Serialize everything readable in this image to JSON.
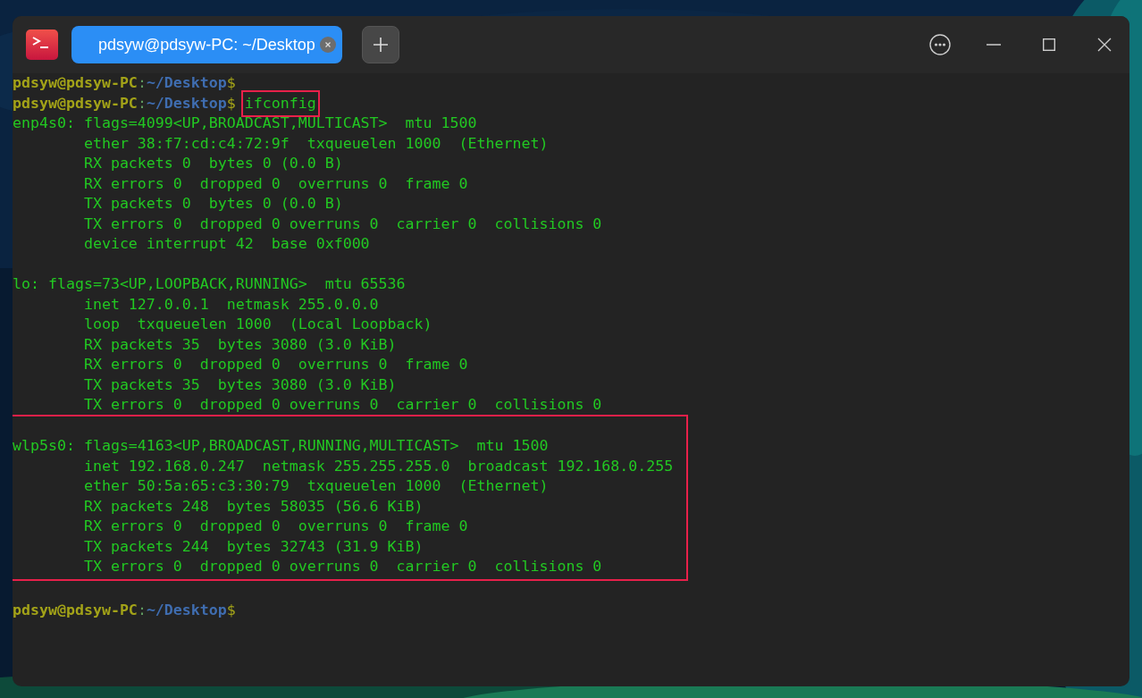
{
  "window": {
    "tab": {
      "title": "pdsyw@pdsyw-PC: ~/Desktop",
      "selected": true
    }
  },
  "terminal": {
    "groups": [
      {
        "highlighted": false,
        "lines": [
          {
            "kind": "prompt",
            "user": "pdsyw@pdsyw-PC",
            "separator": ":",
            "path": "~/Desktop",
            "symbol": "$"
          },
          {
            "kind": "prompt",
            "user": "pdsyw@pdsyw-PC",
            "separator": ":",
            "path": "~/Desktop",
            "symbol": "$",
            "command": "ifconfig",
            "command_highlighted": true
          },
          {
            "kind": "output",
            "text": "enp4s0: flags=4099<UP,BROADCAST,MULTICAST>  mtu 1500"
          },
          {
            "kind": "output",
            "text": "        ether 38:f7:cd:c4:72:9f  txqueuelen 1000  (Ethernet)"
          },
          {
            "kind": "output",
            "text": "        RX packets 0  bytes 0 (0.0 B)"
          },
          {
            "kind": "output",
            "text": "        RX errors 0  dropped 0  overruns 0  frame 0"
          },
          {
            "kind": "output",
            "text": "        TX packets 0  bytes 0 (0.0 B)"
          },
          {
            "kind": "output",
            "text": "        TX errors 0  dropped 0 overruns 0  carrier 0  collisions 0"
          },
          {
            "kind": "output",
            "text": "        device interrupt 42  base 0xf000"
          },
          {
            "kind": "blank"
          },
          {
            "kind": "output",
            "text": "lo: flags=73<UP,LOOPBACK,RUNNING>  mtu 65536"
          },
          {
            "kind": "output",
            "text": "        inet 127.0.0.1  netmask 255.0.0.0"
          },
          {
            "kind": "output",
            "text": "        loop  txqueuelen 1000  (Local Loopback)"
          },
          {
            "kind": "output",
            "text": "        RX packets 35  bytes 3080 (3.0 KiB)"
          },
          {
            "kind": "output",
            "text": "        RX errors 0  dropped 0  overruns 0  frame 0"
          },
          {
            "kind": "output",
            "text": "        TX packets 35  bytes 3080 (3.0 KiB)"
          },
          {
            "kind": "output",
            "text": "        TX errors 0  dropped 0 overruns 0  carrier 0  collisions 0"
          }
        ]
      },
      {
        "highlighted": true,
        "lines": [
          {
            "kind": "blank"
          },
          {
            "kind": "output",
            "text": "wlp5s0: flags=4163<UP,BROADCAST,RUNNING,MULTICAST>  mtu 1500"
          },
          {
            "kind": "output",
            "text": "        inet 192.168.0.247  netmask 255.255.255.0  broadcast 192.168.0.255"
          },
          {
            "kind": "output",
            "text": "        ether 50:5a:65:c3:30:79  txqueuelen 1000  (Ethernet)"
          },
          {
            "kind": "output",
            "text": "        RX packets 248  bytes 58035 (56.6 KiB)"
          },
          {
            "kind": "output",
            "text": "        RX errors 0  dropped 0  overruns 0  frame 0"
          },
          {
            "kind": "output",
            "text": "        TX packets 244  bytes 32743 (31.9 KiB)"
          },
          {
            "kind": "output",
            "text": "        TX errors 0  dropped 0 overruns 0  carrier 0  collisions 0"
          }
        ]
      },
      {
        "highlighted": false,
        "lines": [
          {
            "kind": "blank"
          },
          {
            "kind": "prompt",
            "user": "pdsyw@pdsyw-PC",
            "separator": ":",
            "path": "~/Desktop",
            "symbol": "$"
          }
        ]
      }
    ]
  }
}
